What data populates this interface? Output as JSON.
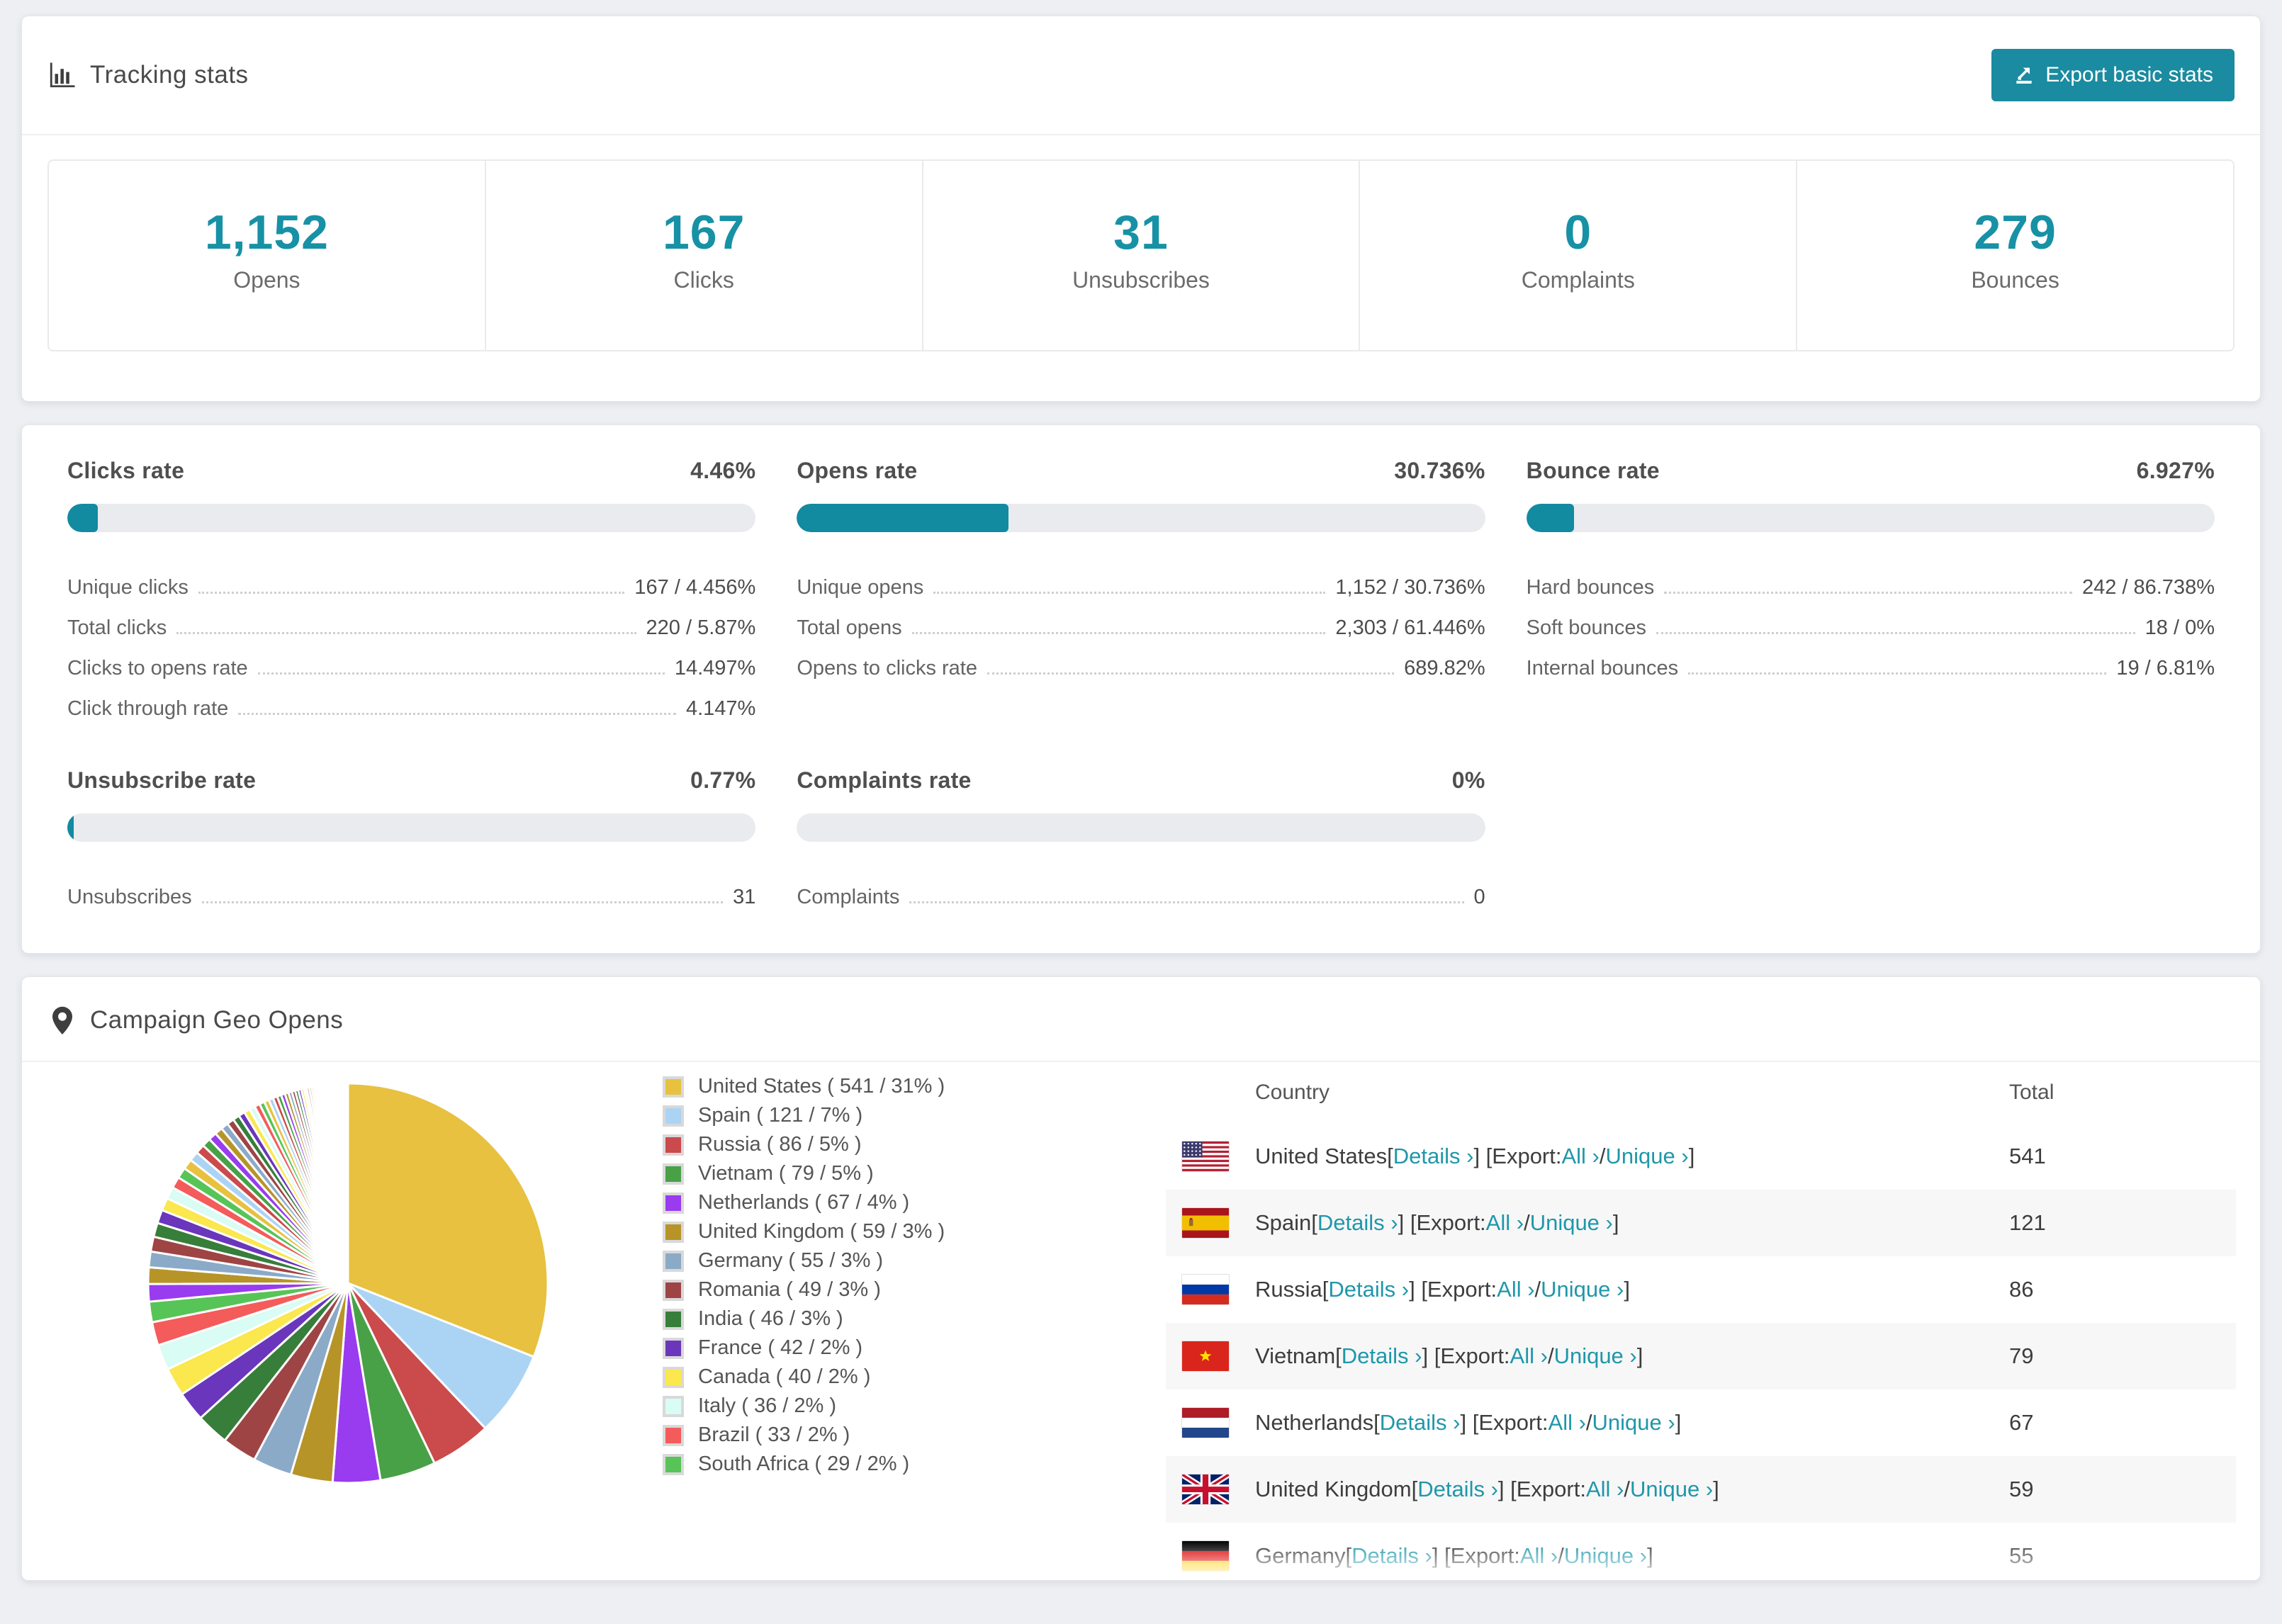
{
  "colors": {
    "accent": "#1791A5",
    "button": "#1A8BA0",
    "bar_fill": "#128AA0",
    "palette": [
      "#E7C13F",
      "#ABD4F4",
      "#CB4A4B",
      "#48A147",
      "#993BEF",
      "#B79428",
      "#8AAAC8",
      "#9E4444",
      "#377E3B",
      "#6A36BC",
      "#FBE74E",
      "#D9FCF4",
      "#F45B5B",
      "#57C457"
    ]
  },
  "tracking": {
    "title": "Tracking stats",
    "export_button": "Export basic stats",
    "stats": [
      {
        "value": "1,152",
        "label": "Opens"
      },
      {
        "value": "167",
        "label": "Clicks"
      },
      {
        "value": "31",
        "label": "Unsubscribes"
      },
      {
        "value": "0",
        "label": "Complaints"
      },
      {
        "value": "279",
        "label": "Bounces"
      }
    ]
  },
  "rates": {
    "blocks": [
      {
        "title": "Clicks rate",
        "value": "4.46%",
        "pct": 4.46,
        "rows": [
          {
            "label": "Unique clicks",
            "value": "167 / 4.456%"
          },
          {
            "label": "Total clicks",
            "value": "220 / 5.87%"
          },
          {
            "label": "Clicks to opens rate",
            "value": "14.497%"
          },
          {
            "label": "Click through rate",
            "value": "4.147%"
          }
        ]
      },
      {
        "title": "Opens rate",
        "value": "30.736%",
        "pct": 30.736,
        "rows": [
          {
            "label": "Unique opens",
            "value": "1,152 / 30.736%"
          },
          {
            "label": "Total opens",
            "value": "2,303 / 61.446%"
          },
          {
            "label": "Opens to clicks rate",
            "value": "689.82%"
          }
        ]
      },
      {
        "title": "Bounce rate",
        "value": "6.927%",
        "pct": 6.927,
        "rows": [
          {
            "label": "Hard bounces",
            "value": "242 / 86.738%"
          },
          {
            "label": "Soft bounces",
            "value": "18 / 0%"
          },
          {
            "label": "Internal bounces",
            "value": "19 / 6.81%"
          }
        ]
      },
      {
        "title": "Unsubscribe rate",
        "value": "0.77%",
        "pct": 0.77,
        "rows": [
          {
            "label": "Unsubscribes",
            "value": "31"
          }
        ]
      },
      {
        "title": "Complaints rate",
        "value": "0%",
        "pct": 0,
        "rows": [
          {
            "label": "Complaints",
            "value": "0"
          }
        ]
      }
    ]
  },
  "geo": {
    "title": "Campaign Geo Opens",
    "legend": [
      "United States ( 541 / 31% )",
      "Spain ( 121 / 7% )",
      "Russia ( 86 / 5% )",
      "Vietnam ( 79 / 5% )",
      "Netherlands ( 67 / 4% )",
      "United Kingdom ( 59 / 3% )",
      "Germany ( 55 / 3% )",
      "Romania ( 49 / 3% )",
      "India ( 46 / 3% )",
      "France ( 42 / 2% )",
      "Canada ( 40 / 2% )",
      "Italy ( 36 / 2% )",
      "Brazil ( 33 / 2% )",
      "South Africa ( 29 / 2% )"
    ],
    "table": {
      "headers": {
        "country": "Country",
        "total": "Total"
      },
      "link_details": "Details ›",
      "export_prefix": "Export:",
      "link_all": "All ›",
      "link_unique": "Unique ›",
      "rows": [
        {
          "flag": "us",
          "country": "United States",
          "total": "541"
        },
        {
          "flag": "es",
          "country": "Spain",
          "total": "121"
        },
        {
          "flag": "ru",
          "country": "Russia",
          "total": "86"
        },
        {
          "flag": "vn",
          "country": "Vietnam",
          "total": "79"
        },
        {
          "flag": "nl",
          "country": "Netherlands",
          "total": "67"
        },
        {
          "flag": "gb",
          "country": "United Kingdom",
          "total": "59"
        },
        {
          "flag": "de",
          "country": "Germany",
          "total": "55"
        }
      ]
    }
  },
  "chart_data": {
    "type": "pie",
    "title": "Campaign Geo Opens",
    "unit": "opens",
    "start_angle_deg": -90,
    "direction": "clockwise",
    "legend_position": "right",
    "slices": [
      {
        "label": "United States",
        "value": 541,
        "pct": 31,
        "color": "#E7C13F"
      },
      {
        "label": "Spain",
        "value": 121,
        "pct": 7,
        "color": "#ABD4F4"
      },
      {
        "label": "Russia",
        "value": 86,
        "pct": 5,
        "color": "#CB4A4B"
      },
      {
        "label": "Vietnam",
        "value": 79,
        "pct": 5,
        "color": "#48A147"
      },
      {
        "label": "Netherlands",
        "value": 67,
        "pct": 4,
        "color": "#993BEF"
      },
      {
        "label": "United Kingdom",
        "value": 59,
        "pct": 3,
        "color": "#B79428"
      },
      {
        "label": "Germany",
        "value": 55,
        "pct": 3,
        "color": "#8AAAC8"
      },
      {
        "label": "Romania",
        "value": 49,
        "pct": 3,
        "color": "#9E4444"
      },
      {
        "label": "India",
        "value": 46,
        "pct": 3,
        "color": "#377E3B"
      },
      {
        "label": "France",
        "value": 42,
        "pct": 2,
        "color": "#6A36BC"
      },
      {
        "label": "Canada",
        "value": 40,
        "pct": 2,
        "color": "#FBE74E"
      },
      {
        "label": "Italy",
        "value": 36,
        "pct": 2,
        "color": "#D9FCF4"
      },
      {
        "label": "Brazil",
        "value": 33,
        "pct": 2,
        "color": "#F45B5B"
      },
      {
        "label": "South Africa",
        "value": 29,
        "pct": 2,
        "color": "#57C457"
      }
    ],
    "others_estimated": {
      "note": "many small unlabeled countries",
      "total_value": 462,
      "count": 70,
      "decay": 0.948
    },
    "total_estimated": 1745
  }
}
